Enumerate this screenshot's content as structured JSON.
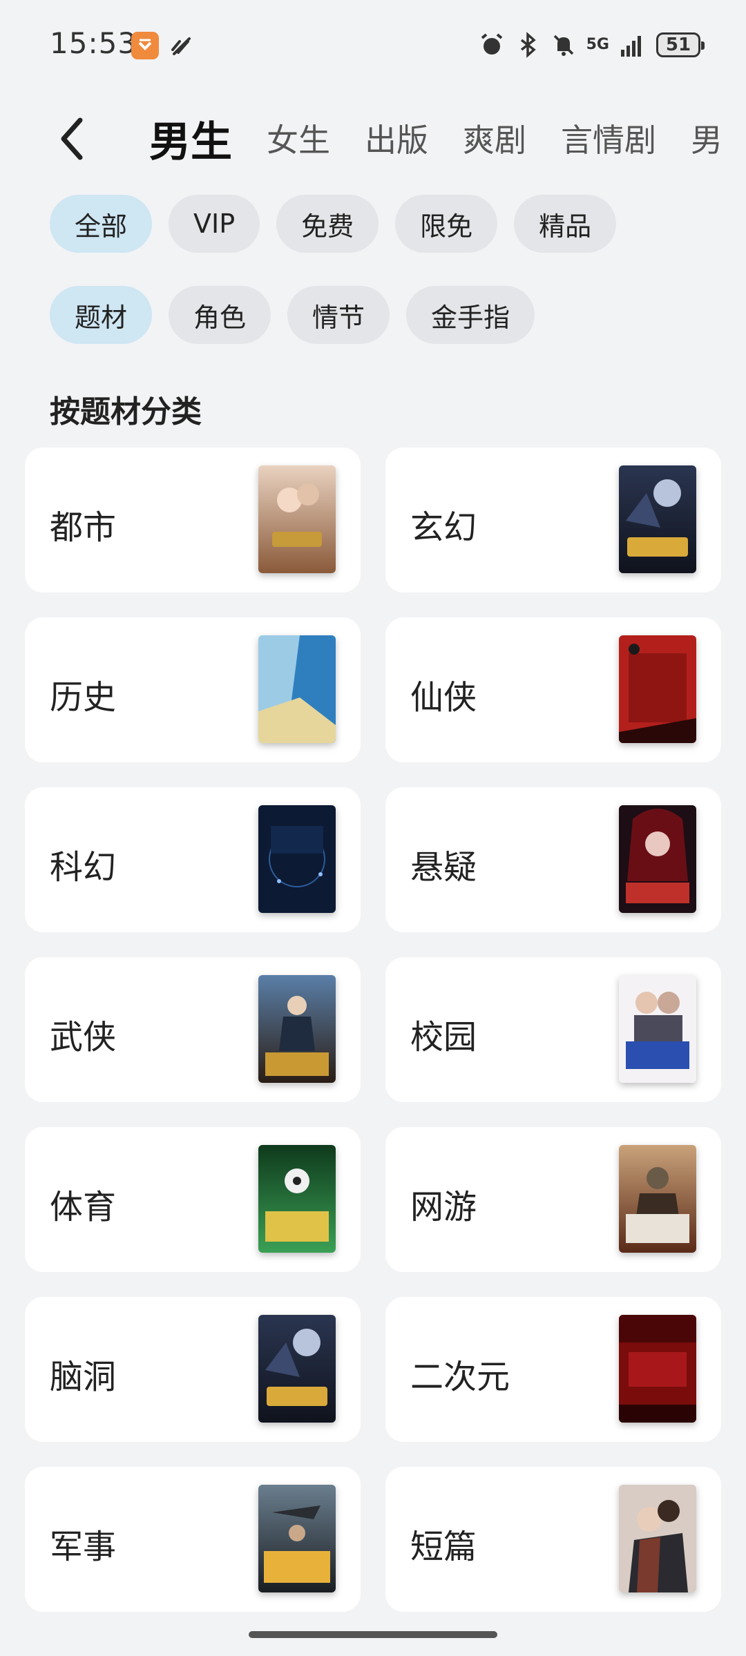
{
  "status_bar": {
    "time": "15:53",
    "network": "5G",
    "battery": "51"
  },
  "header": {
    "tabs": [
      "男生",
      "女生",
      "出版",
      "爽剧",
      "言情剧",
      "男"
    ]
  },
  "filters": {
    "row1": [
      "全部",
      "VIP",
      "免费",
      "限免",
      "精品"
    ],
    "row2": [
      "题材",
      "角色",
      "情节",
      "金手指"
    ]
  },
  "section_title": "按题材分类",
  "categories": [
    {
      "label": "都市"
    },
    {
      "label": "玄幻"
    },
    {
      "label": "历史"
    },
    {
      "label": "仙侠"
    },
    {
      "label": "科幻"
    },
    {
      "label": "悬疑"
    },
    {
      "label": "武侠"
    },
    {
      "label": "校园"
    },
    {
      "label": "体育"
    },
    {
      "label": "网游"
    },
    {
      "label": "脑洞"
    },
    {
      "label": "二次元"
    },
    {
      "label": "军事"
    },
    {
      "label": "短篇"
    }
  ],
  "colors": {
    "background": "#f2f3f5",
    "chip_selected": "#cfe6f3",
    "chip_default": "#e4e5e8"
  },
  "icons": [
    "back-arrow-icon",
    "alarm-icon",
    "bluetooth-icon",
    "mute-icon",
    "signal-icon",
    "battery-icon"
  ]
}
